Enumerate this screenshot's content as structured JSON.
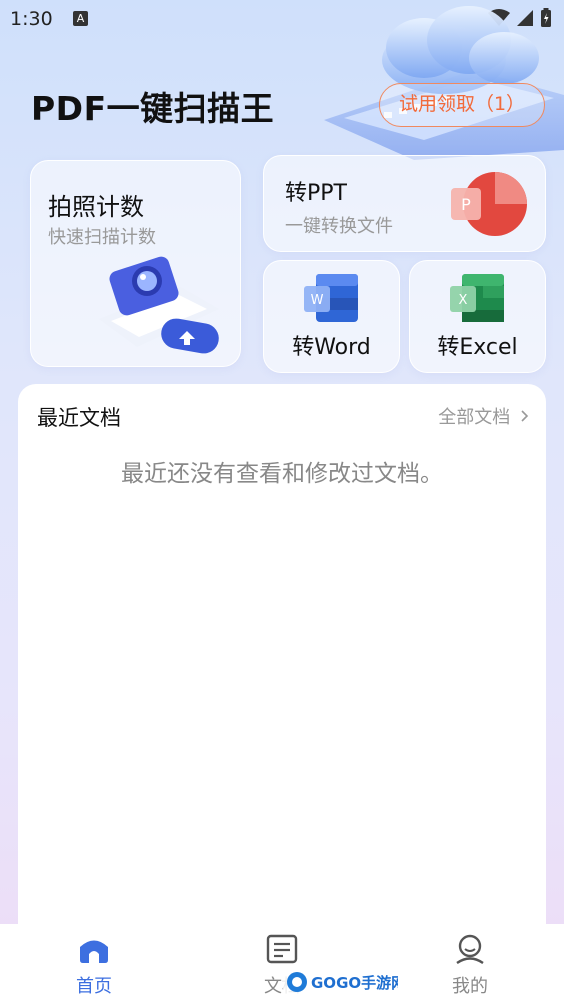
{
  "status_bar": {
    "time": "1:30",
    "notification_letter": "A"
  },
  "app": {
    "title": "PDF一键扫描王",
    "trial_button": "试用领取（1）"
  },
  "cards": {
    "photo": {
      "title": "拍照计数",
      "subtitle": "快速扫描计数"
    },
    "ppt": {
      "title": "转PPT",
      "subtitle": "一键转换文件",
      "icon_letter": "P"
    },
    "word": {
      "title": "转Word",
      "icon_letter": "W"
    },
    "excel": {
      "title": "转Excel",
      "icon_letter": "X"
    }
  },
  "recent": {
    "title": "最近文档",
    "all_link": "全部文档",
    "empty_text": "最近还没有查看和修改过文档。"
  },
  "tabs": [
    {
      "label": "首页",
      "icon": "home-icon",
      "active": true
    },
    {
      "label": "文档",
      "icon": "document-icon",
      "active": false
    },
    {
      "label": "我的",
      "icon": "user-icon",
      "active": false
    }
  ],
  "watermark": {
    "text": "GOGO手游网"
  },
  "colors": {
    "accent": "#3d6fe0",
    "trial": "#f26a3a",
    "ppt": "#e2483f",
    "word": "#2f66d6",
    "excel": "#1e8a4c"
  }
}
